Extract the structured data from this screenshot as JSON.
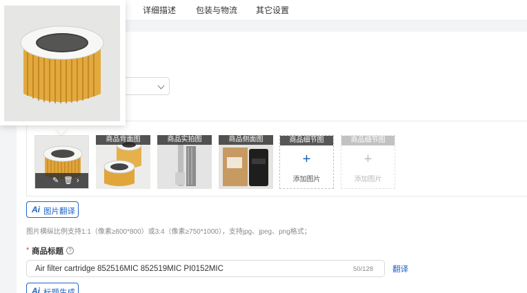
{
  "tabs": [
    {
      "label": "详细描述"
    },
    {
      "label": "包装与物流"
    },
    {
      "label": "其它设置"
    }
  ],
  "images": {
    "thumbnails": [
      {
        "label": ""
      },
      {
        "label": "商品背面图"
      },
      {
        "label": "商品实拍图"
      },
      {
        "label": "商品侧面图"
      },
      {
        "label": "商品细节图"
      },
      {
        "label": "商品细节图"
      }
    ],
    "add_label": "添加图片"
  },
  "image_translate_button": {
    "label": "图片翻译"
  },
  "hint": "图片横纵比例支持1:1（像素≥800*800）或3:4（像素≥750*1000），支持jpg、jpeg、png格式；",
  "title_field": {
    "label": "商品标题",
    "value": "Air filter cartridge 852516MIC 852519MIC PI0152MIC",
    "counter": "50/128"
  },
  "translate_link": "翻译",
  "title_generate_button": {
    "label": "标题生成"
  },
  "colors": {
    "accent": "#1e63c7",
    "required": "#e23b3b"
  }
}
